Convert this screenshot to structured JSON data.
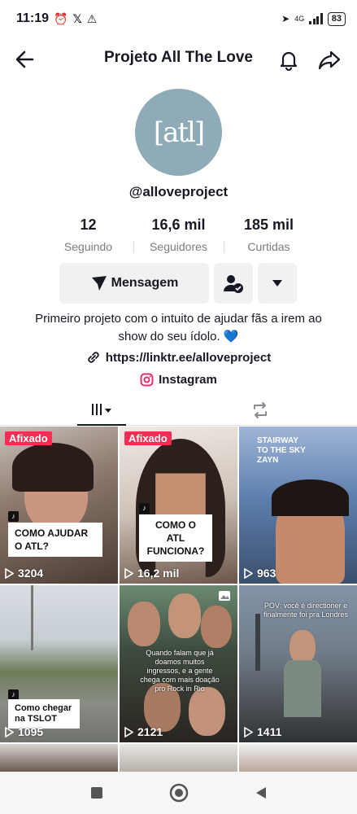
{
  "status": {
    "time": "11:19",
    "network": "4G",
    "battery": "83"
  },
  "header": {
    "title": "Projeto All The Love"
  },
  "profile": {
    "avatar_text": "[atl]",
    "username": "@alloveproject",
    "stats": [
      {
        "value": "12",
        "label": "Seguindo"
      },
      {
        "value": "16,6 mil",
        "label": "Seguidores"
      },
      {
        "value": "185 mil",
        "label": "Curtidas"
      }
    ],
    "message_button": "Mensagem",
    "bio": "Primeiro projeto com o intuito de ajudar fãs a irem ao show do seu ídolo. 💙",
    "link": "https://linktr.ee/alloveproject",
    "instagram": "Instagram"
  },
  "videos": [
    {
      "pinned": "Afixado",
      "caption": "COMO AJUDAR O ATL?",
      "views": "3204"
    },
    {
      "pinned": "Afixado",
      "caption": "COMO O ATL FUNCIONA?",
      "views": "16,2 mil"
    },
    {
      "pinned": "",
      "caption": "STAIRWAY TO THE SKY ZAYN",
      "views": "963"
    },
    {
      "pinned": "",
      "caption": "Como chegar na TSLOT",
      "views": "1095"
    },
    {
      "pinned": "",
      "caption": "Quando falam que já doamos muitos ingressos, e a gente chega com mais doação pro Rock in Rio",
      "views": "2121"
    },
    {
      "pinned": "",
      "caption": "POV: você é directioner e finalmente foi pra Londres",
      "views": "1411"
    }
  ]
}
